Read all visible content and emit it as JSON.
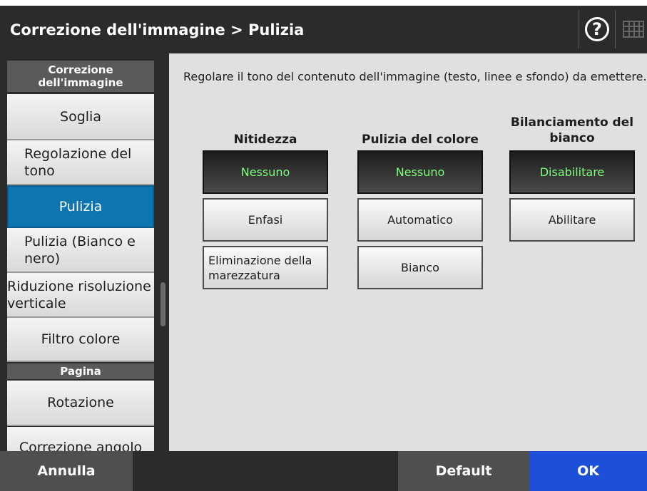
{
  "header": {
    "title": "Correzione dell'immagine > Pulizia",
    "help_symbol": "?",
    "help_icon": "help-icon",
    "keyboard_icon": "keyboard-icon"
  },
  "sidebar": {
    "group_image": "Correzione dell'immagine",
    "items": [
      {
        "label": "Soglia"
      },
      {
        "label": "Regolazione del tono"
      },
      {
        "label": "Pulizia"
      },
      {
        "label": "Pulizia (Bianco e nero)"
      },
      {
        "label": "Riduzione risoluzione verticale"
      },
      {
        "label": "Filtro colore"
      }
    ],
    "group_page": "Pagina",
    "page_items": [
      {
        "label": "Rotazione"
      },
      {
        "label": "Correzione angolo"
      }
    ]
  },
  "content": {
    "description": "Regolare il tono del contenuto dell'immagine (testo, linee e sfondo) da emettere.",
    "columns": [
      {
        "title": "Nitidezza",
        "options": [
          "Nessuno",
          "Enfasi",
          "Eliminazione della marezzatura"
        ],
        "selected": "Nessuno"
      },
      {
        "title": "Pulizia del colore",
        "options": [
          "Nessuno",
          "Automatico",
          "Bianco"
        ],
        "selected": "Nessuno"
      },
      {
        "title": "Bilanciamento del bianco",
        "options": [
          "Disabilitare",
          "Abilitare"
        ],
        "selected": "Disabilitare"
      }
    ]
  },
  "footer": {
    "cancel": "Annulla",
    "default": "Default",
    "ok": "OK"
  },
  "colors": {
    "accent_blue": "#1e4fd8",
    "active_item": "#0e75b3",
    "selected_text": "#7dff7d",
    "dark_bg": "#2b2b2b"
  }
}
